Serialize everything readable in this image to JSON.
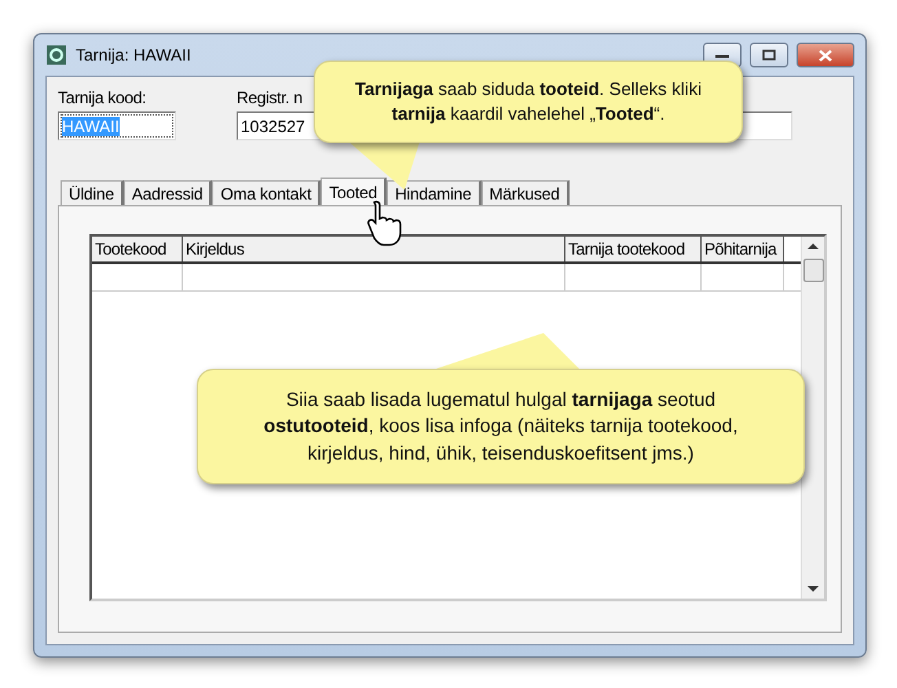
{
  "window": {
    "title": "Tarnija: HAWAII"
  },
  "fields": [
    {
      "label": "Tarnija kood:",
      "value": "HAWAII",
      "selected": true
    },
    {
      "label": "Registr. n",
      "value": "1032527",
      "selected": false
    },
    {
      "selected": false
    }
  ],
  "tabs": [
    {
      "label": "Üldine",
      "selected": false
    },
    {
      "label": "Aadressid",
      "selected": false
    },
    {
      "label": "Oma kontakt",
      "selected": false
    },
    {
      "label": "Tooted",
      "selected": true
    },
    {
      "label": "Hindamine",
      "selected": false
    },
    {
      "label": "Märkused",
      "selected": false
    }
  ],
  "table": {
    "columns": [
      "Tootekood",
      "Kirjeldus",
      "Tarnija tootekood",
      "Põhitarnija"
    ]
  },
  "callouts": [
    "**Tarnijaga** saab siduda **tooteid**. Selleks kliki **tarnija** kaardil vahelehel „**Tooted**“.",
    "Siia saab lisada lugematul hulgal **tarnijaga** seotud **ostutooteid**, koos lisa infoga (näiteks tarnija tootekood, kirjeldus, hind, ühik, teisenduskoefitsent jms.)"
  ]
}
